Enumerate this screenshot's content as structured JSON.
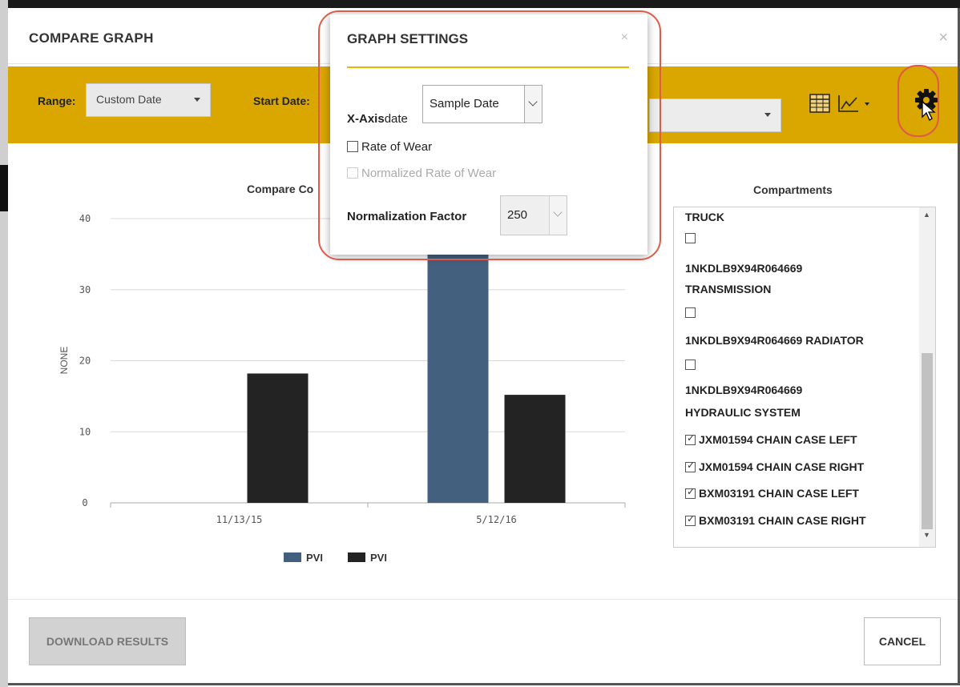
{
  "modal": {
    "title": "COMPARE GRAPH",
    "close_glyph": "×"
  },
  "toolbar": {
    "range_label": "Range:",
    "range_value": "Custom Date",
    "start_date_label": "Start Date:"
  },
  "chart_data": {
    "type": "bar",
    "title": "Compare Co",
    "ylabel": "NONE",
    "ylim": [
      0,
      40
    ],
    "yticks": [
      0,
      10,
      20,
      30,
      40
    ],
    "categories": [
      "11/13/15",
      "5/12/16"
    ],
    "series": [
      {
        "name": "PVI",
        "color": "#44607f",
        "values": [
          null,
          35
        ]
      },
      {
        "name": "PVI",
        "color": "#232323",
        "values": [
          18.2,
          15.2
        ]
      }
    ],
    "legend": "bottom"
  },
  "compartments": {
    "title": "Compartments",
    "items": [
      {
        "text": "TRUCK",
        "has_checkbox": false,
        "checked": false
      },
      {
        "text": "",
        "has_checkbox": true,
        "checked": false
      },
      {
        "text": "1NKDLB9X94R064669",
        "has_checkbox": false,
        "checked": false
      },
      {
        "text": "TRANSMISSION",
        "has_checkbox": false,
        "checked": false
      },
      {
        "text": "",
        "has_checkbox": true,
        "checked": false
      },
      {
        "text": "1NKDLB9X94R064669 RADIATOR",
        "has_checkbox": false,
        "checked": false
      },
      {
        "text": "",
        "has_checkbox": true,
        "checked": false
      },
      {
        "text": "1NKDLB9X94R064669",
        "has_checkbox": false,
        "checked": false
      },
      {
        "text": "HYDRAULIC SYSTEM",
        "has_checkbox": false,
        "checked": false
      },
      {
        "text": "JXM01594 CHAIN CASE LEFT",
        "has_checkbox": true,
        "checked": true
      },
      {
        "text": "JXM01594 CHAIN CASE RIGHT",
        "has_checkbox": true,
        "checked": true
      },
      {
        "text": "BXM03191 CHAIN CASE LEFT",
        "has_checkbox": true,
        "checked": true
      },
      {
        "text": "BXM03191 CHAIN CASE RIGHT",
        "has_checkbox": true,
        "checked": true
      }
    ]
  },
  "footer": {
    "download_label": "DOWNLOAD RESULTS",
    "cancel_label": "CANCEL"
  },
  "graph_settings": {
    "title": "GRAPH SETTINGS",
    "close_glyph": "×",
    "x_axis_label": "X-Axis",
    "x_axis_suffix": "date",
    "x_axis_value": "Sample Date",
    "rate_of_wear_label": "Rate of Wear",
    "rate_of_wear_checked": false,
    "normalized_label": "Normalized Rate of Wear",
    "normalized_enabled": false,
    "normalization_factor_label": "Normalization Factor",
    "normalization_factor_value": "250"
  },
  "icons": {
    "table": "table-icon",
    "line_chart": "line-chart-icon",
    "settings": "gear-icon",
    "cursor": "mouse-pointer-icon"
  },
  "colors": {
    "toolbar": "#d9a700",
    "accent_rule": "#e6b800",
    "highlight": "#e05a4a"
  }
}
